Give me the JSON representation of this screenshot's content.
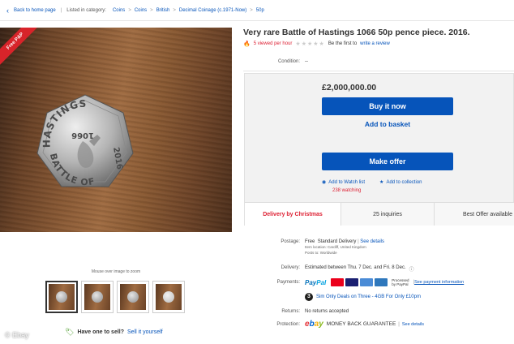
{
  "breadcrumbs": {
    "back": "Back to home page",
    "listed": "Listed in category:",
    "items": [
      "Coins",
      "Coins",
      "British",
      "Decimal Coinage (c.1971-Now)",
      "50p"
    ]
  },
  "photo": {
    "badge": "Free P&P",
    "coin_text_top": "HASTINGS",
    "coin_text_bottom": "BATTLE OF",
    "coin_year": "2016",
    "coin_date": "1066",
    "caption": "Mouse over image to zoom"
  },
  "sell": {
    "question": "Have one to sell?",
    "link": "Sell it yourself"
  },
  "watermark": "© Ebay",
  "listing": {
    "title": "Very rare Battle of Hastings 1066 50p pence piece. 2016.",
    "viewed": "5 viewed per hour",
    "review_pre": "Be the first to",
    "review_link": "write a review",
    "condition_label": "Condition:",
    "condition_value": "--"
  },
  "buybox": {
    "price": "£2,000,000.00",
    "buy_now": "Buy it now",
    "add_basket": "Add to basket",
    "make_offer": "Make offer",
    "watch": "Add to Watch list",
    "collection": "Add to collection",
    "watching": "238 watching",
    "tabs": [
      "Delivery by Christmas",
      "25 inquiries",
      "Best Offer available"
    ]
  },
  "postage": {
    "label": "Postage:",
    "free": "Free",
    "service": "Standard Delivery",
    "details": "See details",
    "location": "Item location:  Cardiff, United Kingdom",
    "posts_to": "Posts to:  Worldwide"
  },
  "delivery": {
    "label": "Delivery:",
    "value": "Estimated between Thu. 7 Dec. and Fri. 8 Dec."
  },
  "payments": {
    "label": "Payments:",
    "paypal_1": "Pay",
    "paypal_2": "Pal",
    "processed_1": "Processed",
    "processed_2": "by PayPal",
    "details": "See payment information",
    "sim": "Sim Only Deals on Three - 4GB For Only £10pm",
    "card_colors": [
      "#eb001b",
      "#1a1f71",
      "#4a8bd6",
      "#2e77bc"
    ]
  },
  "returns": {
    "label": "Returns:",
    "value": "No returns accepted"
  },
  "protection": {
    "label": "Protection:",
    "logo": [
      "e",
      "b",
      "a",
      "y"
    ],
    "value": "MONEY BACK GUARANTEE",
    "details": "See details"
  }
}
